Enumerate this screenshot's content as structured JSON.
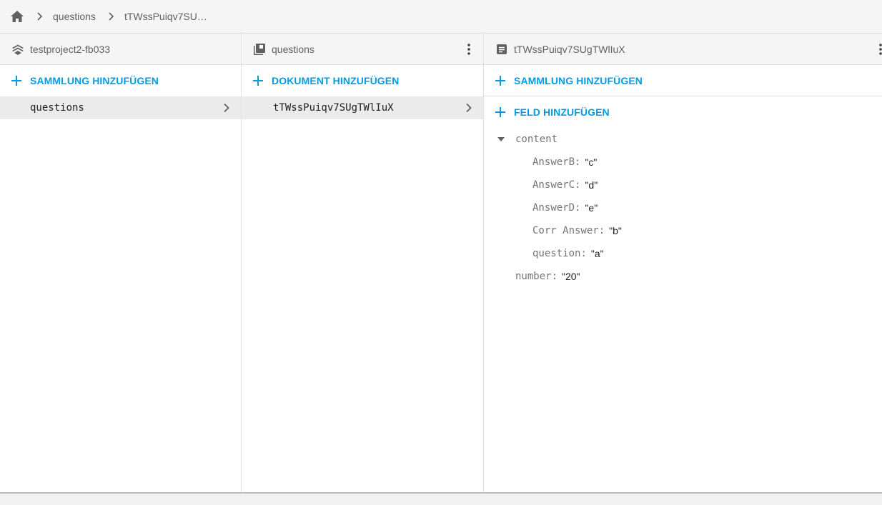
{
  "breadcrumb": {
    "home_icon": "home-icon",
    "items": [
      "questions",
      "tTWssPuiqv7SU…"
    ]
  },
  "panels": {
    "root": {
      "title": "testproject2-fb033",
      "icon": "firestore-icon",
      "add_label": "SAMMLUNG HINZUFÜGEN",
      "items": [
        "questions"
      ]
    },
    "collection": {
      "title": "questions",
      "icon": "collection-icon",
      "add_label": "DOKUMENT HINZUFÜGEN",
      "items": [
        "tTWssPuiqv7SUgTWlIuX"
      ]
    },
    "document": {
      "title": "tTWssPuiqv7SUgTWlIuX",
      "icon": "document-icon",
      "add_collection_label": "SAMMLUNG HINZUFÜGEN",
      "add_field_label": "FELD HINZUFÜGEN",
      "map_field": "content",
      "sub_fields": [
        {
          "key": "AnswerB",
          "value": "\"c\""
        },
        {
          "key": "AnswerC",
          "value": "\"d\""
        },
        {
          "key": "AnswerD",
          "value": "\"e\""
        },
        {
          "key": "Corr Answer",
          "value": "\"b\""
        },
        {
          "key": "question",
          "value": "\"a\""
        }
      ],
      "top_fields": [
        {
          "key": "number",
          "value": "\"20\""
        }
      ]
    }
  },
  "colors": {
    "accent": "#039be5",
    "selected_row": "#ebebeb",
    "header_bg": "#f5f5f5"
  }
}
